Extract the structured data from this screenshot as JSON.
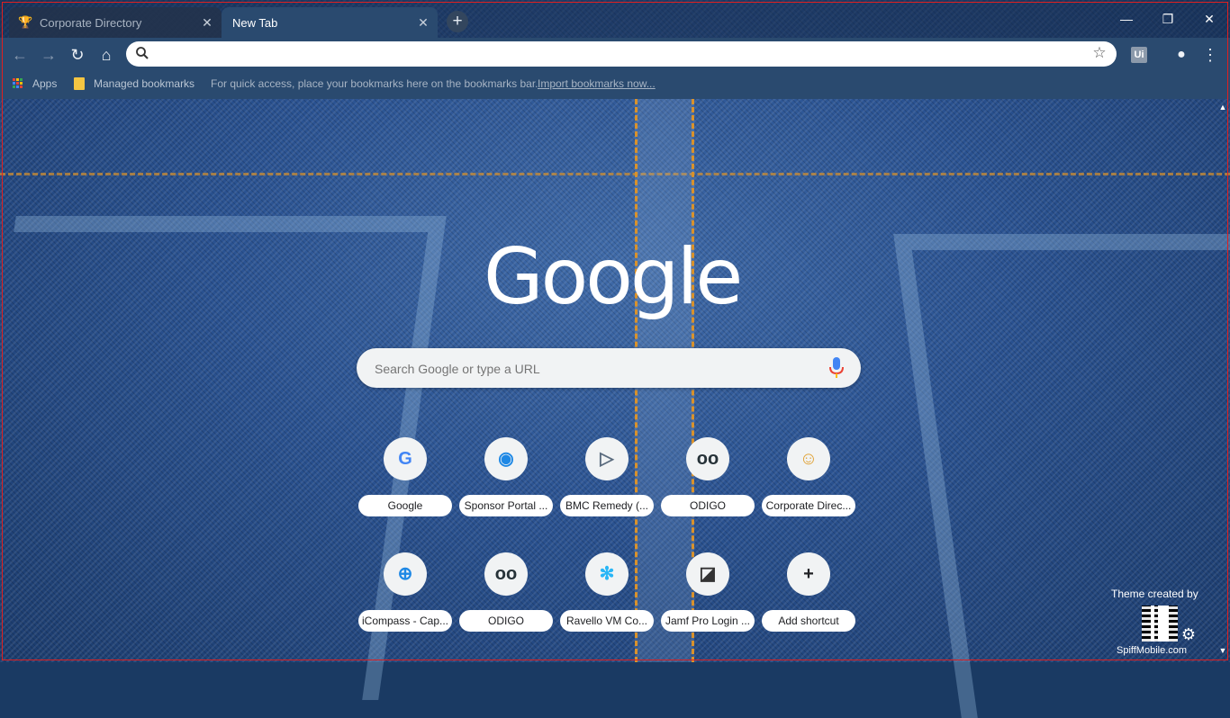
{
  "tabs": [
    {
      "title": "Corporate Directory",
      "favicon": "corporate-directory-icon",
      "active": false
    },
    {
      "title": "New Tab",
      "active": true
    }
  ],
  "window_controls": {
    "minimize": "—",
    "restore": "❐",
    "close": "✕"
  },
  "toolbar": {
    "back": "←",
    "forward": "→",
    "reload": "↻",
    "home": "⌂",
    "omnibox_value": "",
    "star": "☆",
    "extension_label": "Ui",
    "profile": "●",
    "menu": "⋮"
  },
  "bookmarks_bar": {
    "apps": "Apps",
    "managed": "Managed bookmarks",
    "hint": "For quick access, place your bookmarks here on the bookmarks bar.",
    "import": "Import bookmarks now..."
  },
  "ntp": {
    "logo_text": "Google",
    "search_placeholder": "Search Google or type a URL",
    "shortcuts": [
      {
        "label": "Google",
        "glyph": "G",
        "color": "#4285f4",
        "icon": "google-icon"
      },
      {
        "label": "Sponsor Portal ...",
        "glyph": "◉",
        "color": "#1e88e5",
        "icon": "sponsor-portal-icon"
      },
      {
        "label": "BMC Remedy (...",
        "glyph": "▷",
        "color": "#5a6b7e",
        "icon": "bmc-remedy-icon"
      },
      {
        "label": "ODIGO",
        "glyph": "oo",
        "color": "#263238",
        "icon": "odigo-icon"
      },
      {
        "label": "Corporate Direc...",
        "glyph": "☺",
        "color": "#e0a030",
        "icon": "corporate-directory-icon"
      },
      {
        "label": "iCompass - Cap...",
        "glyph": "⊕",
        "color": "#1e88e5",
        "icon": "icompass-icon"
      },
      {
        "label": "ODIGO",
        "glyph": "oo",
        "color": "#263238",
        "icon": "odigo-icon"
      },
      {
        "label": "Ravello VM Co...",
        "glyph": "✻",
        "color": "#29b6f6",
        "icon": "ravello-icon"
      },
      {
        "label": "Jamf Pro Login ...",
        "glyph": "◪",
        "color": "#333333",
        "icon": "jamf-pro-icon"
      },
      {
        "label": "Add shortcut",
        "glyph": "+",
        "color": "#202124",
        "icon": "add-shortcut-icon"
      }
    ]
  },
  "theme": {
    "credit": "Theme created by",
    "site": "SpiffMobile.com"
  }
}
